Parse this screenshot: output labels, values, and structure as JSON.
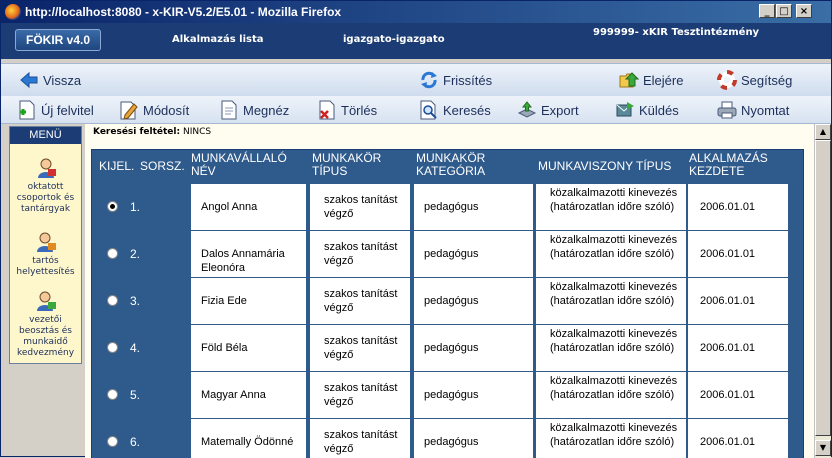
{
  "window": {
    "title": "http://localhost:8080 - x-KIR-V5.2/E5.01 - Mozilla Firefox",
    "buttons": [
      "_",
      "□",
      "×"
    ]
  },
  "header": {
    "logo": "FÖKIR v4.0",
    "list_title": "Alkalmazás lista",
    "user": "igazgato-igazgato",
    "institution": "999999- xKIR Tesztintézmény"
  },
  "toolbar_top": {
    "back": "Vissza",
    "refresh": "Frissítés",
    "prev": "Elejére",
    "help": "Segítség"
  },
  "toolbar_actions": {
    "new": "Új felvitel",
    "modify": "Módosít",
    "view": "Megnéz",
    "delete": "Törlés",
    "search": "Keresés",
    "export": "Export",
    "send": "Küldés",
    "print": "Nyomtat"
  },
  "menu": {
    "title": "MENÜ",
    "items": [
      {
        "label": "oktatott csoportok és tantárgyak"
      },
      {
        "label": "tartós helyettesítés"
      },
      {
        "label": "vezetői beosztás és munkaidő kedvezmény"
      }
    ]
  },
  "filter": {
    "label": "Keresési feltétel:",
    "value": "NINCS"
  },
  "table": {
    "columns": [
      "KIJEL.",
      "SORSZ.",
      "MUNKAVÁLLALÓ NÉV",
      "MUNKAKÖR TÍPUS",
      "MUNKAKÖR KATEGÓRIA",
      "MUNKAVISZONY TÍPUS",
      "ALKALMAZÁS KEZDETE"
    ],
    "rows": [
      {
        "selected": true,
        "sorsz": "1.",
        "nev": "Angol Anna",
        "tipus": "szakos tanítást végző",
        "kategoria": "pedagógus",
        "viszony": "közalkalmazotti kinevezés (határozatlan időre szóló)",
        "kezdete": "2006.01.01"
      },
      {
        "selected": false,
        "sorsz": "2.",
        "nev": "Dalos Annamária Eleonóra",
        "tipus": "szakos tanítást végző",
        "kategoria": "pedagógus",
        "viszony": "közalkalmazotti kinevezés (határozatlan időre szóló)",
        "kezdete": "2006.01.01"
      },
      {
        "selected": false,
        "sorsz": "3.",
        "nev": "Fizia Ede",
        "tipus": "szakos tanítást végző",
        "kategoria": "pedagógus",
        "viszony": "közalkalmazotti kinevezés (határozatlan időre szóló)",
        "kezdete": "2006.01.01"
      },
      {
        "selected": false,
        "sorsz": "4.",
        "nev": "Föld Béla",
        "tipus": "szakos tanítást végző",
        "kategoria": "pedagógus",
        "viszony": "közalkalmazotti kinevezés (határozatlan időre szóló)",
        "kezdete": "2006.01.01"
      },
      {
        "selected": false,
        "sorsz": "5.",
        "nev": "Magyar Anna",
        "tipus": "szakos tanítást végző",
        "kategoria": "pedagógus",
        "viszony": "közalkalmazotti kinevezés (határozatlan időre szóló)",
        "kezdete": "2006.01.01"
      },
      {
        "selected": false,
        "sorsz": "6.",
        "nev": "Matemally Ödönné",
        "tipus": "szakos tanítást végző",
        "kategoria": "pedagógus",
        "viszony": "közalkalmazotti kinevezés (határozatlan időre szóló)",
        "kezdete": "2006.01.01"
      }
    ]
  },
  "colors": {
    "header_bg": "#1b3c74",
    "table_header": "#2f5a8c",
    "menu_bg": "#fff7cc"
  }
}
